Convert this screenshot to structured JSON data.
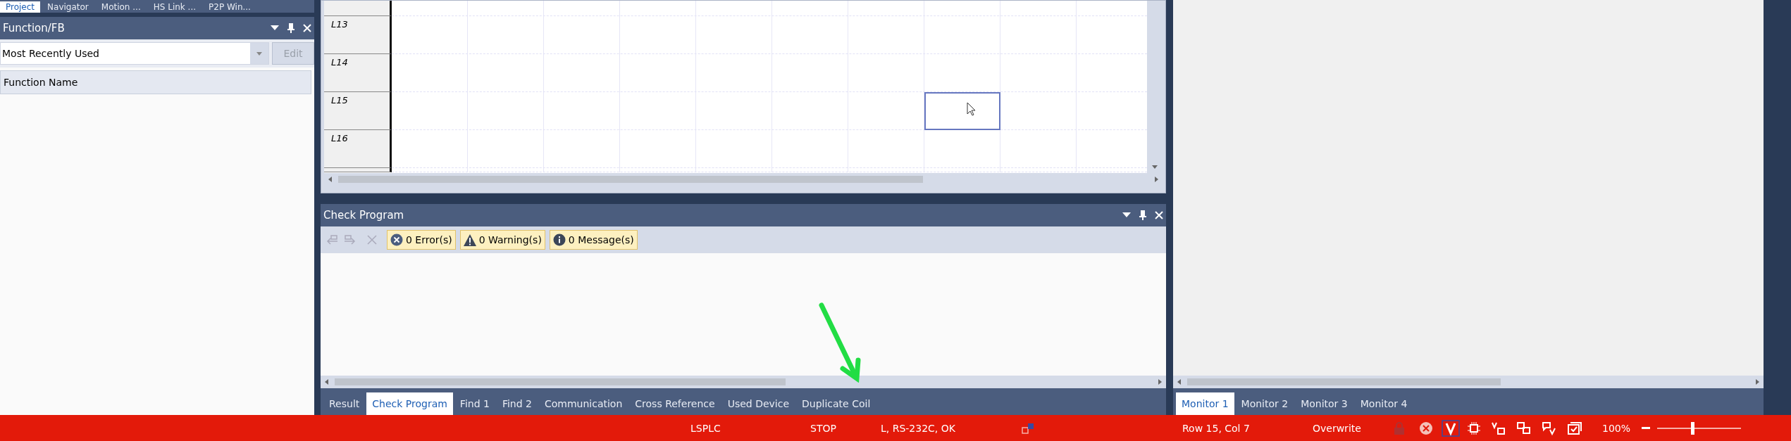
{
  "top_tabs": [
    {
      "label": "Project",
      "selected": true
    },
    {
      "label": "Navigator",
      "selected": false
    },
    {
      "label": "Motion ...",
      "selected": false
    },
    {
      "label": "HS Link ...",
      "selected": false
    },
    {
      "label": "P2P Win...",
      "selected": false
    }
  ],
  "function_panel": {
    "title": "Function/FB",
    "dropdown": {
      "value": "Most Recently Used"
    },
    "edit_button": {
      "label": "Edit",
      "disabled": true
    },
    "column": "Function Name"
  },
  "ladder": {
    "rows": [
      {
        "label": "L13",
        "selected": false
      },
      {
        "label": "L14",
        "selected": false
      },
      {
        "label": "L15",
        "selected": true
      },
      {
        "label": "L16",
        "selected": false
      }
    ]
  },
  "check_program": {
    "title": "Check Program",
    "badges": [
      {
        "kind": "error",
        "label": "0 Error(s)"
      },
      {
        "kind": "warning",
        "label": "0 Warning(s)"
      },
      {
        "kind": "info",
        "label": "0 Message(s)"
      }
    ],
    "tabs": [
      {
        "label": "Result",
        "selected": false
      },
      {
        "label": "Check Program",
        "selected": true
      },
      {
        "label": "Find 1",
        "selected": false
      },
      {
        "label": "Find 2",
        "selected": false
      },
      {
        "label": "Communication",
        "selected": false
      },
      {
        "label": "Cross Reference",
        "selected": false
      },
      {
        "label": "Used Device",
        "selected": false
      },
      {
        "label": "Duplicate Coil",
        "selected": false
      }
    ]
  },
  "monitor_tabs": [
    {
      "label": "Monitor 1",
      "selected": true
    },
    {
      "label": "Monitor 2",
      "selected": false
    },
    {
      "label": "Monitor 3",
      "selected": false
    },
    {
      "label": "Monitor 4",
      "selected": false
    }
  ],
  "status_bar": {
    "plc": "LSPLC",
    "mode": "STOP",
    "connection": "L, RS-232C, OK",
    "position": "Row 15, Col 7",
    "input_mode": "Overwrite",
    "zoom": {
      "reading": "100%",
      "level": 0.4
    }
  }
}
